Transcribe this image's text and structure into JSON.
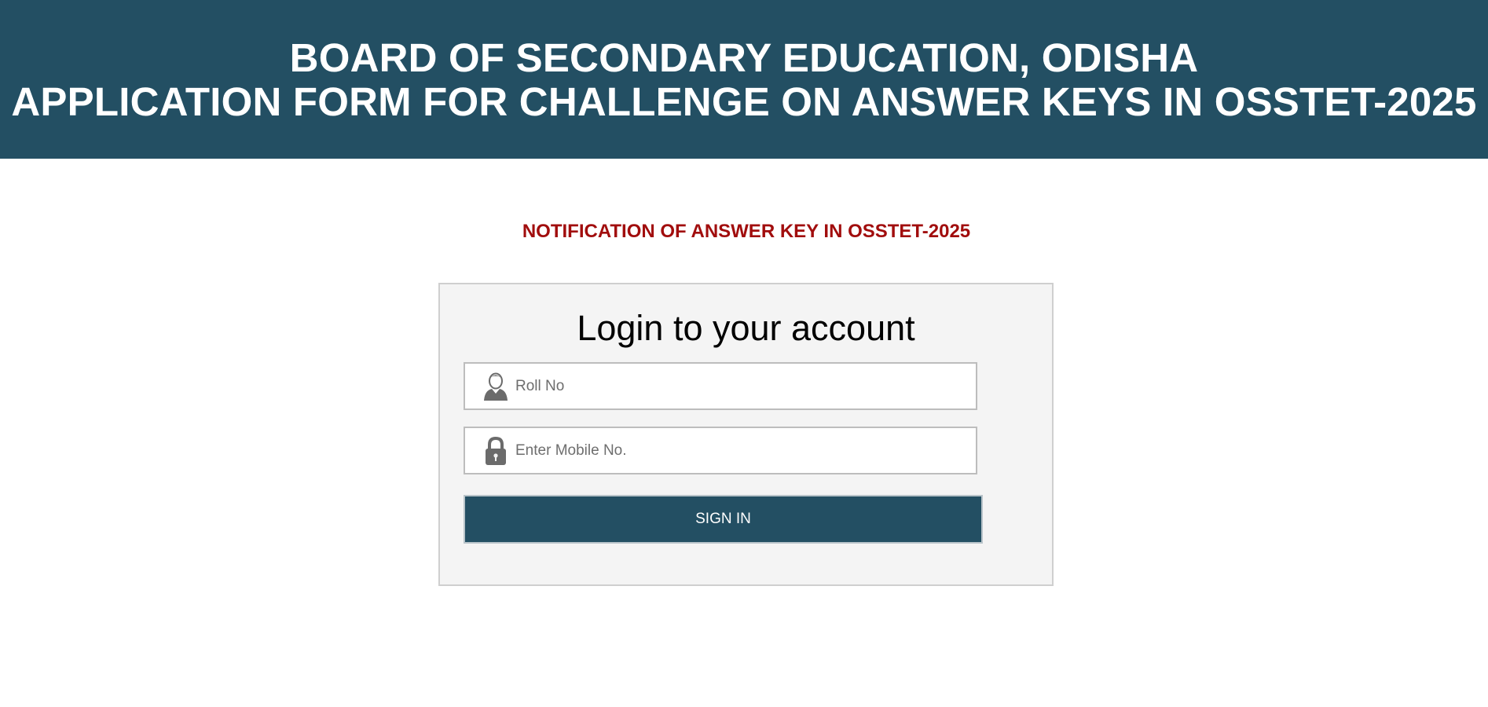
{
  "header": {
    "line1": "BOARD OF SECONDARY EDUCATION, ODISHA",
    "line2": "APPLICATION FORM FOR CHALLENGE ON ANSWER KEYS IN OSSTET-2025",
    "bg_color": "#234f63"
  },
  "notification": {
    "text": "NOTIFICATION OF ANSWER KEY IN OSSTET-2025",
    "color": "#a10d0d"
  },
  "login": {
    "title": "Login to your account",
    "roll": {
      "placeholder": "Roll No",
      "value": "",
      "icon": "user-icon"
    },
    "mobile": {
      "placeholder": "Enter Mobile No.",
      "value": "",
      "icon": "lock-icon"
    },
    "signin_label": "SIGN IN"
  }
}
